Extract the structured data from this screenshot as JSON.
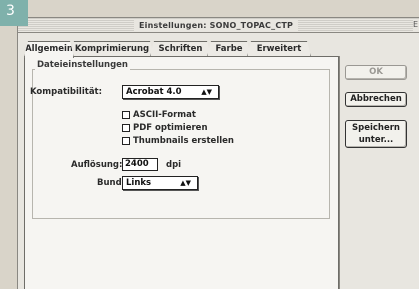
{
  "badge": "3",
  "window": {
    "title": "Einstellungen: SONO_TOPAC_CTP",
    "title_edge": "E"
  },
  "tabs": [
    {
      "label": "Allgemein",
      "active": true
    },
    {
      "label": "Komprimierung",
      "active": false
    },
    {
      "label": "Schriften",
      "active": false
    },
    {
      "label": "Farbe",
      "active": false
    },
    {
      "label": "Erweitert",
      "active": false
    }
  ],
  "group": {
    "label": "Dateieinstellungen",
    "compat_label": "Kompatibilität:",
    "compat_value": "Acrobat 4.0",
    "checkboxes": [
      {
        "label": "ASCII-Format",
        "checked": false
      },
      {
        "label": "PDF optimieren",
        "checked": false
      },
      {
        "label": "Thumbnails erstellen",
        "checked": false
      }
    ],
    "resolution_label": "Auflösung:",
    "resolution_value": "2400",
    "resolution_unit": "dpi",
    "bund_label": "Bund:",
    "bund_value": "Links"
  },
  "buttons": {
    "ok": "OK",
    "cancel": "Abbrechen",
    "save_as_line1": "Speichern",
    "save_as_line2": "unter..."
  },
  "icons": {
    "popup_arrows": "updown-arrows-icon"
  }
}
